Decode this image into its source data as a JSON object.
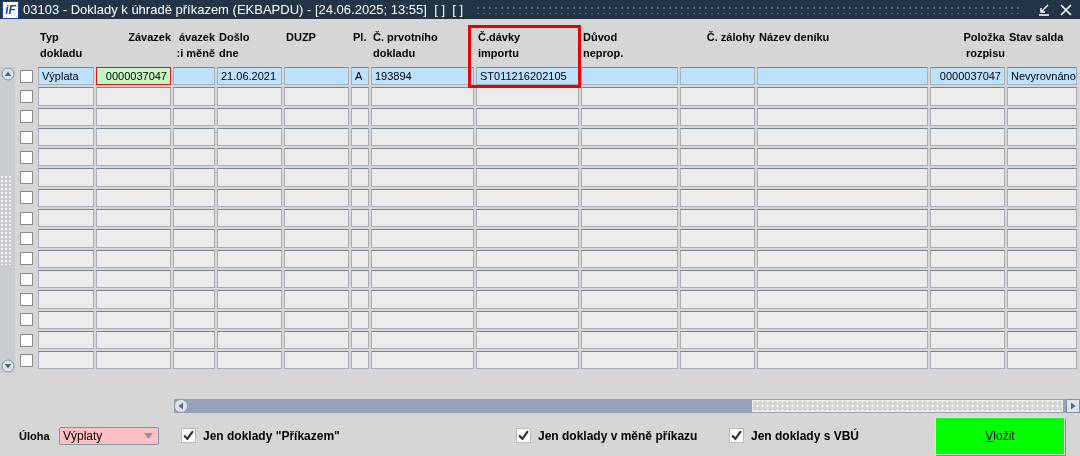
{
  "window": {
    "logo": "iF",
    "title": "03103 - Doklady k úhradě příkazem (EKBAPDU) - [24.06.2025; 13:55]  [ ]  [ ]"
  },
  "table": {
    "columns": [
      {
        "lines": [
          "Typ",
          "dokladu"
        ]
      },
      {
        "lines": [
          "Závazek"
        ]
      },
      {
        "lines": [
          "ávazek",
          ":i měně"
        ]
      },
      {
        "lines": [
          "Došlo",
          "dne"
        ]
      },
      {
        "lines": [
          "DUZP"
        ]
      },
      {
        "lines": [
          "Pl."
        ]
      },
      {
        "lines": [
          "Č. prvotního",
          "dokladu"
        ]
      },
      {
        "lines": [
          "Č.dávky",
          "importu"
        ],
        "highlighted": true
      },
      {
        "lines": [
          "Důvod",
          "neprop."
        ]
      },
      {
        "lines": [
          "Č. zálohy"
        ]
      },
      {
        "lines": [
          "Název deníku"
        ]
      },
      {
        "lines": [
          "Položka",
          "rozpisu"
        ]
      },
      {
        "lines": [
          "Stav salda"
        ]
      }
    ],
    "rows": [
      {
        "selected": true,
        "checked": false,
        "cells": [
          {
            "text": "Výplata"
          },
          {
            "text": "0000037047",
            "focused": true
          },
          null,
          {
            "text": "21.06.2021"
          },
          null,
          {
            "text": "A"
          },
          {
            "text": "193894"
          },
          {
            "text": "ST011216202105"
          },
          null,
          null,
          null,
          {
            "text": "0000037047"
          },
          {
            "text": "Nevyrovnáno"
          }
        ]
      },
      {
        "selected": false,
        "checked": false
      },
      {
        "selected": false,
        "checked": false
      },
      {
        "selected": false,
        "checked": false
      },
      {
        "selected": false,
        "checked": false
      },
      {
        "selected": false,
        "checked": false
      },
      {
        "selected": false,
        "checked": false
      },
      {
        "selected": false,
        "checked": false
      },
      {
        "selected": false,
        "checked": false
      },
      {
        "selected": false,
        "checked": false
      },
      {
        "selected": false,
        "checked": false
      },
      {
        "selected": false,
        "checked": false
      },
      {
        "selected": false,
        "checked": false
      },
      {
        "selected": false,
        "checked": false
      },
      {
        "selected": false,
        "checked": false
      }
    ]
  },
  "footer": {
    "task_label": "Úloha",
    "task_value": "Výplaty",
    "filters": [
      {
        "label": "Jen doklady \"Příkazem\"",
        "checked": true
      },
      {
        "label": "Jen doklady v měně příkazu",
        "checked": true
      },
      {
        "label": "Jen doklady s VBÚ",
        "checked": true
      }
    ],
    "button": "Vložit"
  }
}
